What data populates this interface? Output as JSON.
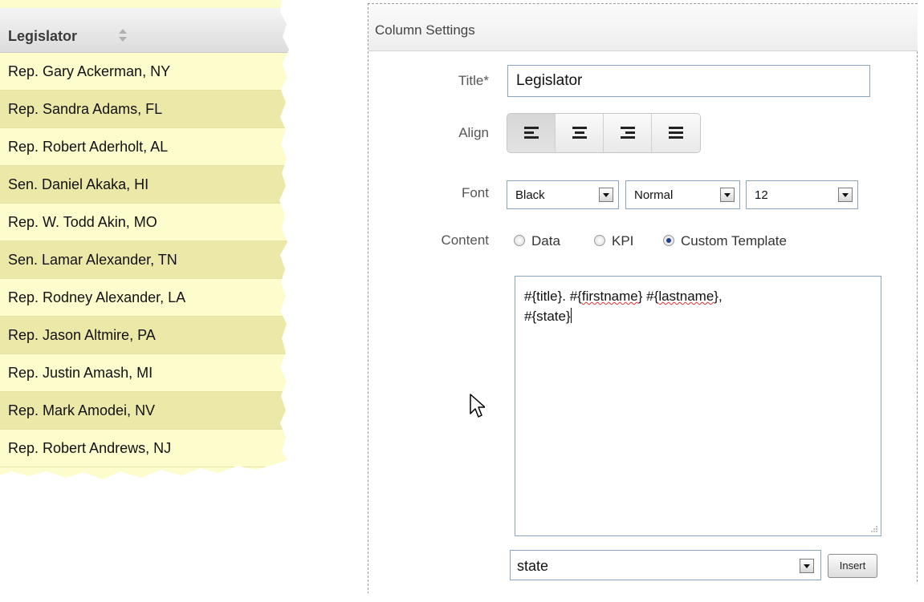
{
  "legislator_table": {
    "header": "Legislator",
    "rows": [
      "Rep. Gary Ackerman, NY",
      "Rep. Sandra Adams, FL",
      "Rep. Robert Aderholt, AL",
      "Sen. Daniel Akaka, HI",
      "Rep. W. Todd Akin, MO",
      "Sen. Lamar Alexander, TN",
      "Rep. Rodney Alexander, LA",
      "Rep. Jason Altmire, PA",
      "Rep. Justin Amash, MI",
      "Rep. Mark Amodei, NV",
      "Rep. Robert Andrews, NJ"
    ],
    "sort_icon": "sort-up-down-icon"
  },
  "column_settings": {
    "panel_title": "Column Settings",
    "title_label": "Title*",
    "title_value": "Legislator",
    "align_label": "Align",
    "align_options": [
      "align-left-icon",
      "align-center-icon",
      "align-right-icon",
      "align-justify-icon"
    ],
    "align_selected": "align-left-icon",
    "font_label": "Font",
    "font_color": "Black",
    "font_style": "Normal",
    "font_size": "12",
    "content_label": "Content",
    "content_options": [
      "Data",
      "KPI",
      "Custom Template"
    ],
    "content_selected": "Custom Template",
    "template_parts": {
      "p1": "#{title}. #{",
      "w1": "firstname",
      "p2": "} #{",
      "w2": "lastname",
      "p3": "},",
      "p4": "#{state}"
    },
    "field_select": "state",
    "insert_label": "Insert"
  },
  "colors": {
    "row_light": "#fdfccc",
    "row_dark": "#ece8a8",
    "input_border": "#8aa6c1",
    "radio_checked": "#1e3d8a"
  }
}
